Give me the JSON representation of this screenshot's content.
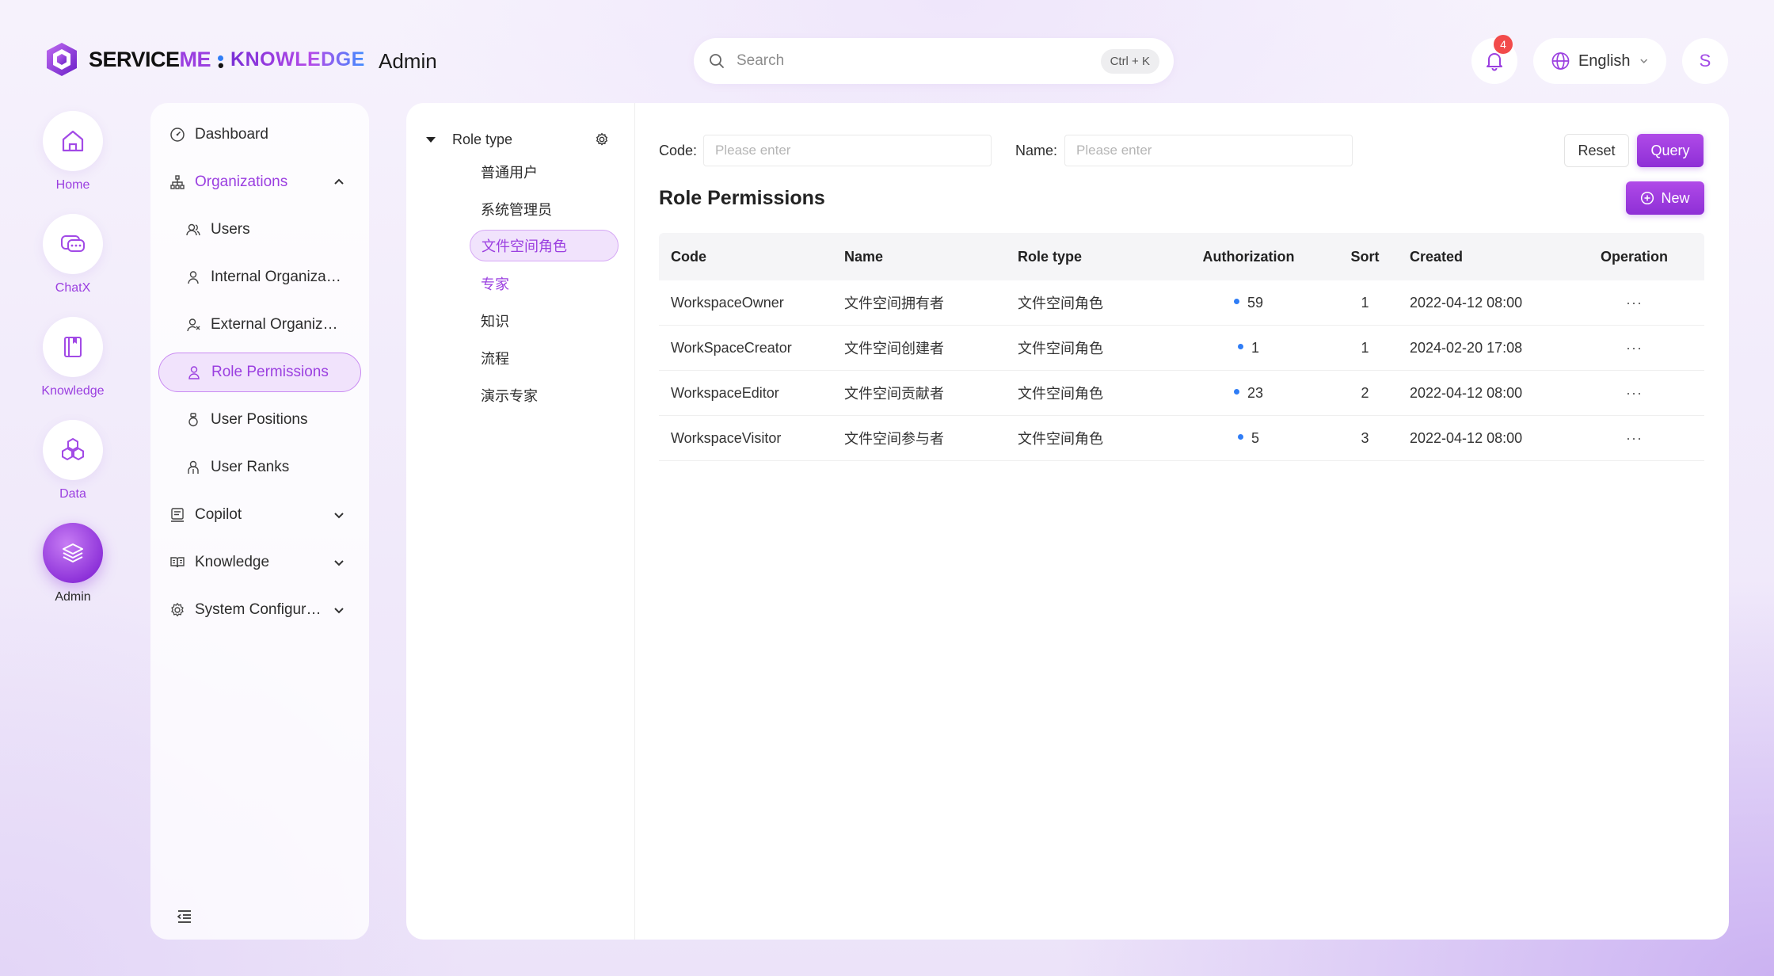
{
  "header": {
    "logo_part1": "SERVICE",
    "logo_part2": "ME",
    "logo_dot": "•",
    "logo_part3": "KNOWLEDGE",
    "page_title": "Admin",
    "search_placeholder": "Search",
    "search_shortcut": "Ctrl + K",
    "notification_count": "4",
    "language": "English",
    "avatar_initial": "S"
  },
  "rail": {
    "items": [
      {
        "label": "Home",
        "icon": "home-icon"
      },
      {
        "label": "ChatX",
        "icon": "chat-icon"
      },
      {
        "label": "Knowledge",
        "icon": "book-icon"
      },
      {
        "label": "Data",
        "icon": "hexagons-icon"
      },
      {
        "label": "Admin",
        "icon": "layers-icon",
        "active": true
      }
    ]
  },
  "nav": {
    "dashboard": "Dashboard",
    "organizations": "Organizations",
    "users": "Users",
    "internal_org": "Internal Organizati...",
    "external_org": "External Organizati...",
    "role_permissions": "Role Permissions",
    "user_positions": "User Positions",
    "user_ranks": "User Ranks",
    "copilot": "Copilot",
    "knowledge": "Knowledge",
    "system_config": "System Configurati..."
  },
  "tree": {
    "root": "Role type",
    "nodes": [
      "普通用户",
      "系统管理员",
      "文件空间角色",
      "专家",
      "知识",
      "流程",
      "演示专家"
    ]
  },
  "filters": {
    "code_label": "Code",
    "code_placeholder": "Please enter",
    "name_label": "Name",
    "name_placeholder": "Please enter",
    "reset": "Reset",
    "query": "Query"
  },
  "section": {
    "title": "Role Permissions",
    "new_button": "New"
  },
  "table": {
    "columns": [
      "Code",
      "Name",
      "Role type",
      "Authorization",
      "Sort",
      "Created",
      "Operation"
    ],
    "rows": [
      {
        "code": "WorkspaceOwner",
        "name": "文件空间拥有者",
        "role_type": "文件空间角色",
        "authorization": "59",
        "sort": "1",
        "created": "2022-04-12 08:00",
        "op": "···"
      },
      {
        "code": "WorkSpaceCreator",
        "name": "文件空间创建者",
        "role_type": "文件空间角色",
        "authorization": "1",
        "sort": "1",
        "created": "2024-02-20 17:08",
        "op": "···"
      },
      {
        "code": "WorkspaceEditor",
        "name": "文件空间贡献者",
        "role_type": "文件空间角色",
        "authorization": "23",
        "sort": "2",
        "created": "2022-04-12 08:00",
        "op": "···"
      },
      {
        "code": "WorkspaceVisitor",
        "name": "文件空间参与者",
        "role_type": "文件空间角色",
        "authorization": "5",
        "sort": "3",
        "created": "2022-04-12 08:00",
        "op": "···"
      }
    ]
  },
  "colors": {
    "accent": "#9b3fe0",
    "dot": "#2f7df6",
    "badge": "#f24b4b"
  }
}
